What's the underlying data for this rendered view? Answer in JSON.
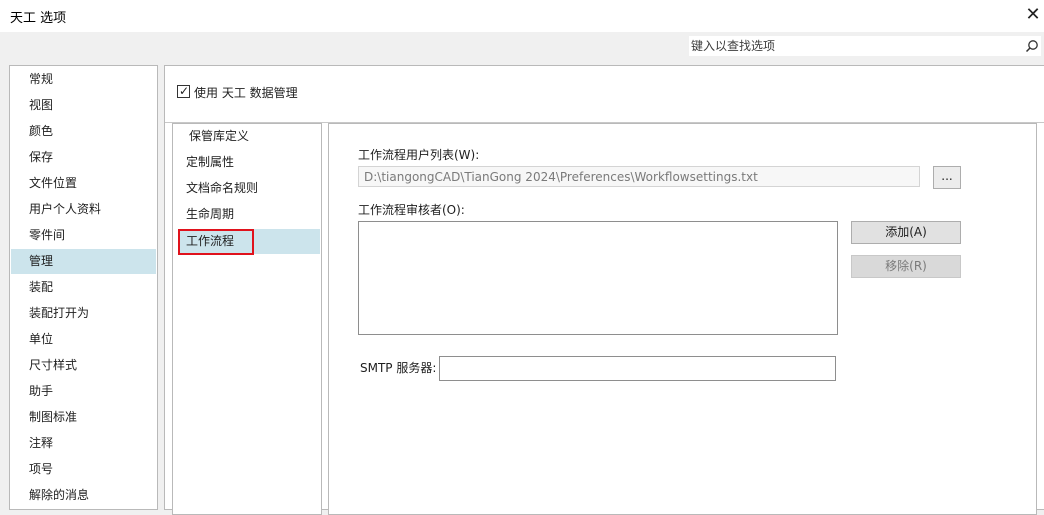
{
  "window": {
    "title": "天工 选项",
    "close_glyph": "✕"
  },
  "search": {
    "placeholder": "键入以查找选项",
    "icon": "search-icon"
  },
  "nav": {
    "items": [
      {
        "label": "常规"
      },
      {
        "label": "视图"
      },
      {
        "label": "颜色"
      },
      {
        "label": "保存"
      },
      {
        "label": "文件位置"
      },
      {
        "label": "用户个人资料"
      },
      {
        "label": "零件间"
      },
      {
        "label": "管理",
        "selected": true
      },
      {
        "label": "装配"
      },
      {
        "label": "装配打开为"
      },
      {
        "label": "单位"
      },
      {
        "label": "尺寸样式"
      },
      {
        "label": "助手"
      },
      {
        "label": "制图标准"
      },
      {
        "label": "注释"
      },
      {
        "label": "项号"
      },
      {
        "label": "解除的消息"
      }
    ]
  },
  "management": {
    "use_data_management": {
      "label": "使用 天工 数据管理",
      "checked": true,
      "check_glyph": "✓"
    },
    "subnav": {
      "items": [
        {
          "label": "保管库定义"
        },
        {
          "label": "定制属性"
        },
        {
          "label": "文档命名规则"
        },
        {
          "label": "生命周期"
        },
        {
          "label": "工作流程",
          "selected": true
        }
      ]
    },
    "workflow": {
      "user_list_label": "工作流程用户列表(W):",
      "user_list_path": "D:\\tiangongCAD\\TianGong 2024\\Preferences\\Workflowsettings.txt",
      "browse_label": "...",
      "reviewer_label": "工作流程审核者(O):",
      "add_label": "添加(A)",
      "remove_label": "移除(R)",
      "smtp_label": "SMTP 服务器:",
      "smtp_value": ""
    }
  },
  "colors": {
    "selection": "#cce4ec",
    "highlight_border": "#e0121c"
  }
}
